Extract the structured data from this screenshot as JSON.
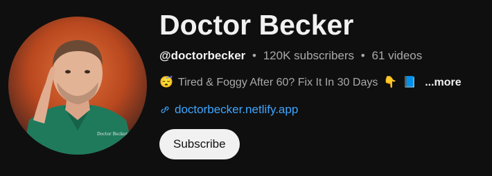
{
  "channel": {
    "name": "Doctor Becker",
    "handle": "@doctorbecker",
    "subscribers": "120K subscribers",
    "videos": "61 videos",
    "separator": "•"
  },
  "description": {
    "text": "Tired & Foggy After 60? Fix It In 30 Days",
    "more_label": "...more",
    "icons": [
      "sleepy-face-emoji",
      "pointing-down-emoji",
      "blue-book-emoji"
    ]
  },
  "link": {
    "text": "doctorbecker.netlify.app",
    "icon": "link-icon"
  },
  "subscribe": {
    "label": "Subscribe"
  },
  "colors": {
    "background": "#0f0f0f",
    "title": "#f1f1f1",
    "meta": "#aaaaaa",
    "link": "#3ea6ff",
    "button_bg": "#f1f1f1",
    "button_text": "#0f0f0f"
  }
}
